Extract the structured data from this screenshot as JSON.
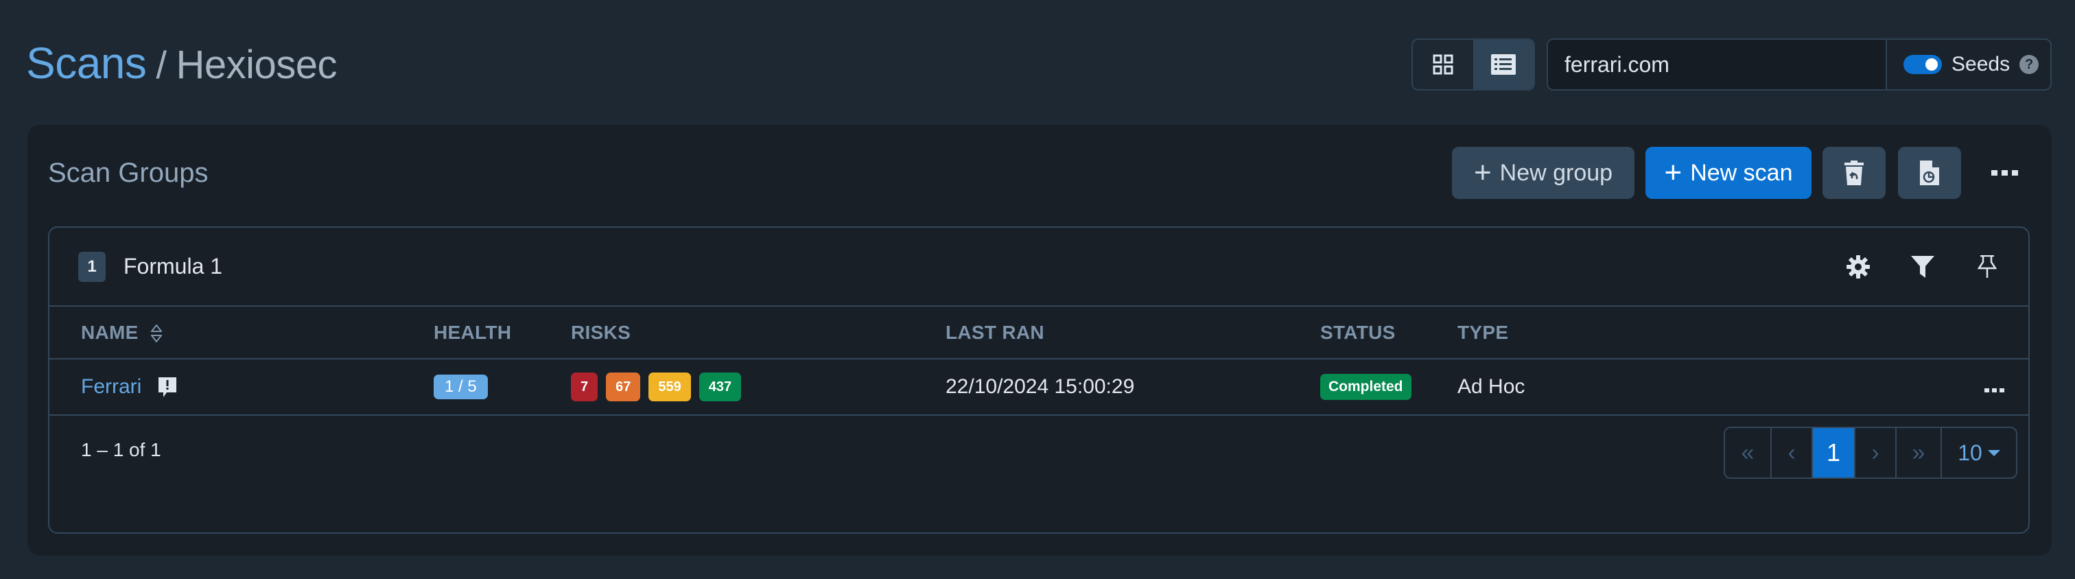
{
  "header": {
    "breadcrumb": {
      "link": "Scans",
      "separator": "/",
      "current": "Hexiosec"
    },
    "view_toggle": {
      "options": [
        {
          "icon": "grid-icon",
          "active": false
        },
        {
          "icon": "list-icon",
          "active": true
        }
      ]
    },
    "search": {
      "value": "ferrari.com",
      "placeholder": ""
    },
    "seeds": {
      "label": "Seeds",
      "enabled": true,
      "help": "?"
    }
  },
  "panel": {
    "title": "Scan Groups",
    "actions": {
      "new_group": "New group",
      "new_scan": "New scan",
      "restore_icon": "trash-restore-icon",
      "report_icon": "file-chart-icon",
      "more": "more-icon"
    }
  },
  "group": {
    "count": "1",
    "name": "Formula 1",
    "tools": [
      "gear-icon",
      "filter-icon",
      "pin-icon"
    ],
    "columns": [
      "NAME",
      "HEALTH",
      "RISKS",
      "LAST RAN",
      "STATUS",
      "TYPE"
    ],
    "rows": [
      {
        "name": "Ferrari",
        "has_note": true,
        "health": "1 / 5",
        "risks": [
          {
            "value": "7",
            "level": "critical",
            "color": "#b0222c"
          },
          {
            "value": "67",
            "level": "high",
            "color": "#e0712e"
          },
          {
            "value": "559",
            "level": "medium",
            "color": "#efb325"
          },
          {
            "value": "437",
            "level": "low",
            "color": "#058a4f"
          }
        ],
        "last_ran": "22/10/2024 15:00:29",
        "status": {
          "label": "Completed",
          "color": "#058a4f"
        },
        "type": "Ad Hoc"
      }
    ],
    "footer": {
      "range": "1 – 1 of 1",
      "pagination": {
        "first": "«",
        "prev": "‹",
        "current": "1",
        "next": "›",
        "last": "»",
        "page_size": "10"
      }
    }
  },
  "colors": {
    "accent": "#0b72d2",
    "link": "#64a8e4",
    "background": "#1d2833",
    "panel": "#181f27",
    "border": "#33475a"
  }
}
